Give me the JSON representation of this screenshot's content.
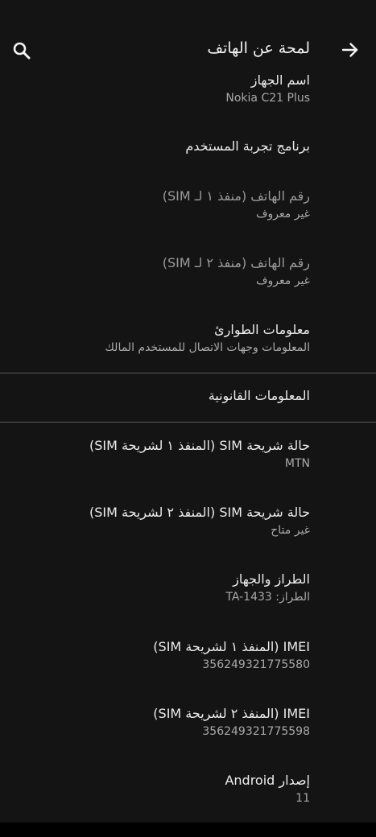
{
  "header": {
    "title": "لمحة عن الهاتف",
    "back_icon": "arrow-forward-icon",
    "search_icon": "search-icon"
  },
  "items": [
    {
      "title": "اسم الجهاز",
      "subtitle": "Nokia C21 Plus"
    },
    {
      "title": "برنامج تجربة المستخدم",
      "subtitle": ""
    },
    {
      "title": "رقم الهاتف (منفذ ١ لـ SIM)",
      "subtitle": "غير معروف"
    },
    {
      "title": "رقم الهاتف (منفذ ٢ لـ SIM)",
      "subtitle": "غير معروف"
    },
    {
      "title": "معلومات الطوارئ",
      "subtitle": "المعلومات وجهات الاتصال للمستخدم المالك"
    },
    {
      "title": "المعلومات القانونية",
      "subtitle": ""
    },
    {
      "title": "حالة شريحة SIM (المنفذ ١ لشريحة SIM)",
      "subtitle": "MTN"
    },
    {
      "title": "حالة شريحة SIM (المنفذ ٢ لشريحة SIM)",
      "subtitle": "غير متاح"
    },
    {
      "title": "الطراز والجهاز",
      "subtitle": "الطراز: TA-1433"
    },
    {
      "title": "IMEI (المنفذ ١ لشريحة SIM)",
      "subtitle": "356249321775580"
    },
    {
      "title": "IMEI (المنفذ ٢ لشريحة SIM)",
      "subtitle": "356249321775598"
    },
    {
      "title": "إصدار Android",
      "subtitle": "11"
    }
  ]
}
